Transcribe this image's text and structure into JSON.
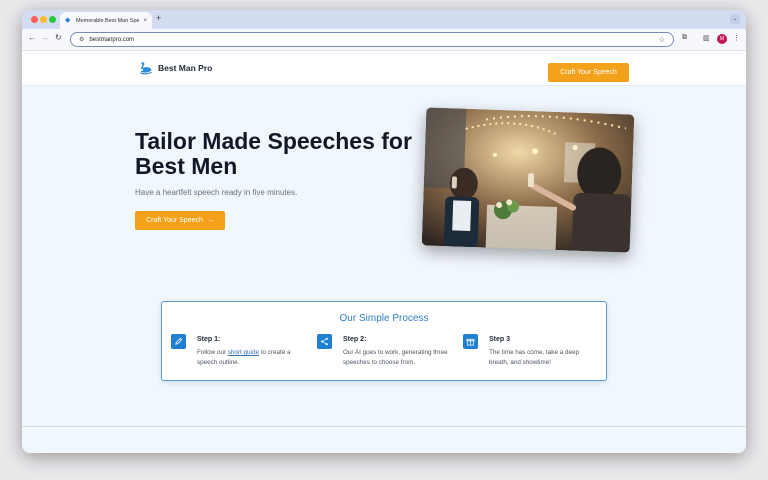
{
  "browser": {
    "tab_title": "Memorable Best Man Speech",
    "tab_close": "×",
    "new_tab": "+",
    "menu_button": "⌄",
    "url": "bestmanpro.com",
    "avatar_letter": "M",
    "accent": "#d4dcf1"
  },
  "site": {
    "logo_text": "Best Man Pro",
    "nav_cta": "Craft Your Speech",
    "brand_color": "#f3a01b",
    "hero": {
      "title": "Tailor Made Speeches for Best Men",
      "subtitle": "Have a heartfelt speech ready in five minutes.",
      "cta": "Craft Your Speech",
      "cta_arrow": "→"
    },
    "process": {
      "title": "Our Simple Process",
      "steps": [
        {
          "heading": "Step 1:",
          "text_before": "Follow our ",
          "link": "short guide",
          "text_after": " to create a speech outline.",
          "icon": "pencil-icon"
        },
        {
          "heading": "Step 2:",
          "text": "Our AI goes to work, generating three speeches to choose from.",
          "icon": "share-nodes-icon"
        },
        {
          "heading": "Step 3",
          "text": "The time has come, take a deep breath, and showtime!",
          "icon": "gift-icon"
        }
      ]
    }
  }
}
